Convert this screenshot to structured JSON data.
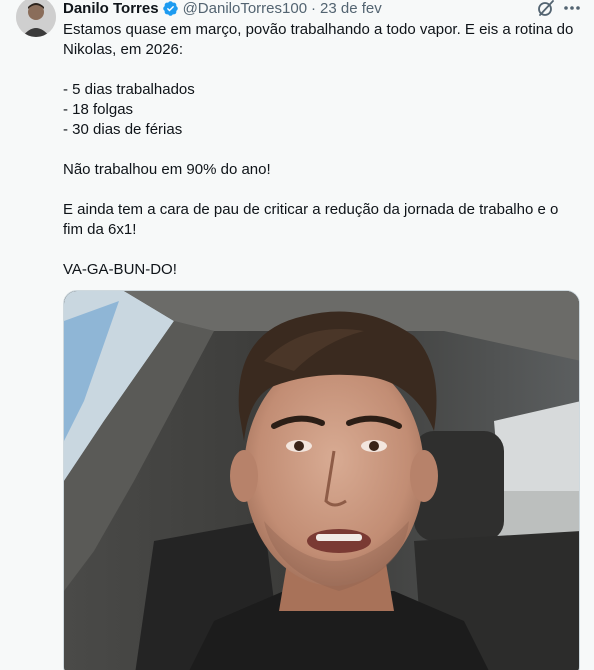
{
  "author": {
    "display_name": "Danilo Torres",
    "handle": "@DaniloTorres100",
    "separator": "·",
    "date": "23 de fev",
    "verified": true
  },
  "icons": {
    "verified": "verified-badge-icon",
    "grok": "grok-icon",
    "more": "more-options-icon"
  },
  "tweet": {
    "lines": [
      "Estamos quase em março, povão trabalhando a todo vapor. E eis a rotina do Nikolas, em 2026:",
      "",
      "- 5 dias trabalhados",
      "- 18 folgas",
      "- 30 dias de férias",
      "",
      "Não trabalhou em 90% do ano!",
      "",
      "E ainda tem a cara de pau de criticar a redução da jornada de trabalho e o fim da 6x1!",
      "",
      "VA-GA-BUN-DO!"
    ]
  },
  "colors": {
    "verified_blue": "#1d9bf0",
    "secondary_text": "#536471",
    "primary_text": "#0f1419",
    "background": "#f7f9f9"
  }
}
